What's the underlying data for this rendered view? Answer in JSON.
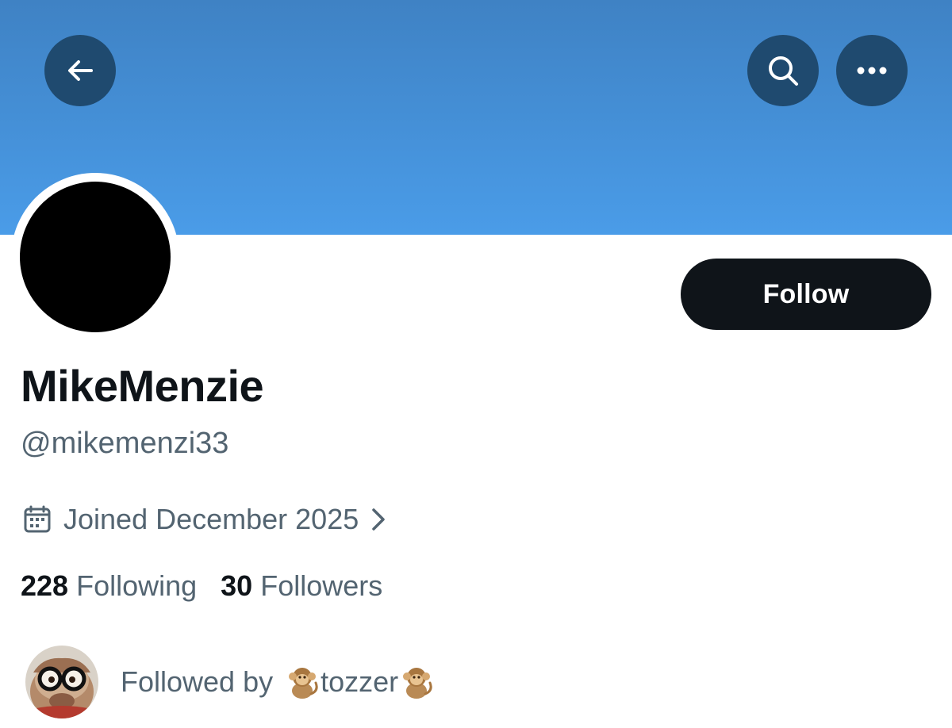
{
  "header": {
    "back_icon": "arrow-left-icon",
    "search_icon": "search-icon",
    "more_icon": "more-horizontal-icon",
    "banner_color": "#4a9ce8",
    "button_bg_color": "#1f4a6f"
  },
  "profile": {
    "display_name": "MikeMenzie",
    "handle": "@mikemenzi33",
    "joined": "Joined December 2025",
    "follow_label": "Follow",
    "avatar_color": "#000000"
  },
  "stats": {
    "following_count": "228",
    "following_label": "Following",
    "followers_count": "30",
    "followers_label": "Followers"
  },
  "followed_by": {
    "prefix": "Followed by",
    "name": "tozzer",
    "emoji_icon": "monkey-emoji"
  },
  "colors": {
    "text_primary": "#0f1419",
    "text_secondary": "#536471",
    "follow_button": "#0f1419"
  }
}
